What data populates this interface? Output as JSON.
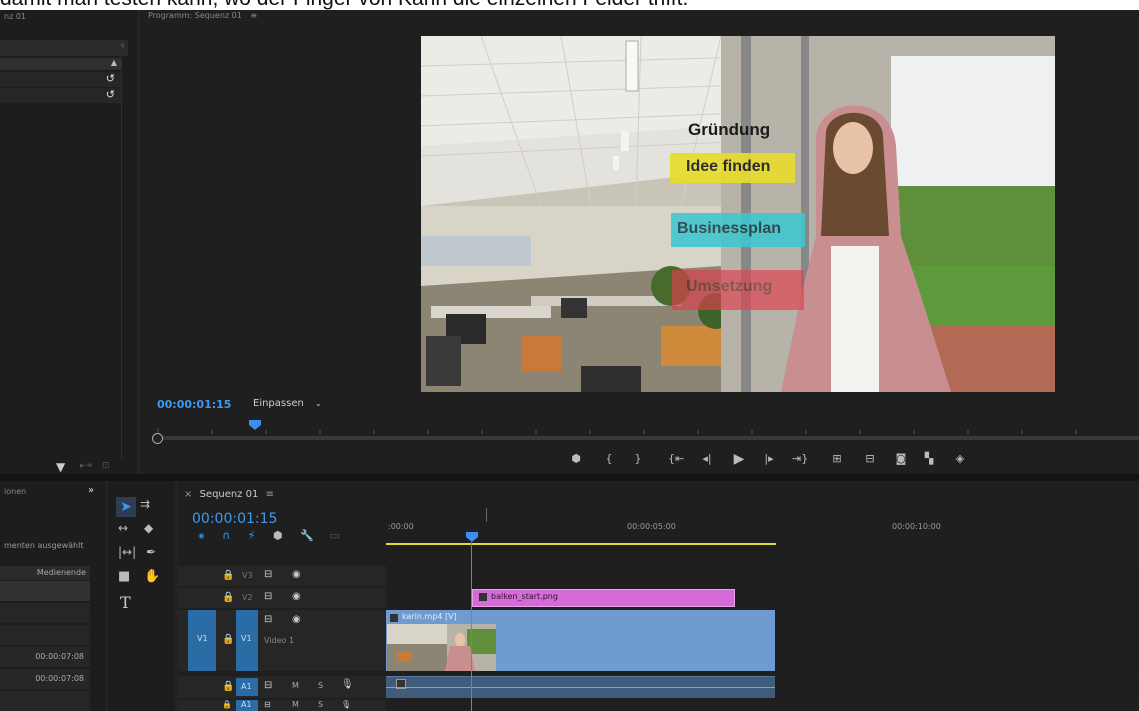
{
  "caption": {
    "text": "damit man testen kann, wo der Finger von Karin die einzelnen Felder trifft."
  },
  "left_top_panel": {
    "title_fragment": "nz 01"
  },
  "program_monitor": {
    "title": "Programm: Sequenz 01",
    "menu_icon": "hamburger-icon",
    "timecode": "00:00:01:15",
    "fit_label": "Einpassen",
    "video_labels": {
      "header": "Gründung",
      "item1": "Idee finden",
      "item2": "Businessplan",
      "item3": "Umsetzung"
    },
    "colors": {
      "item1": "#e7dc2e",
      "item2": "#3ec7cf",
      "item3": "#e0404e"
    }
  },
  "effects_panel": {
    "tab_fragment": "ionen",
    "selection_text": "menten ausgewählt",
    "column_header": "Medienende",
    "rows": [
      "00:00:07:08",
      "00:00:07:08"
    ]
  },
  "timeline": {
    "tab_label": "Sequenz 01",
    "timecode": "00:00:01:15",
    "ruler_labels": [
      ":00:00",
      "00:00:05:00",
      "00:00:10:00"
    ],
    "tracks": {
      "v3": "V3",
      "v2": "V2",
      "v1": "V1",
      "v1_source": "V1",
      "video_name": "Video 1",
      "a1": "A1",
      "a1_source": "A1",
      "m": "M",
      "s": "S"
    },
    "clips": {
      "png": "balken_start.png",
      "video": "karin.mp4 [V]"
    }
  }
}
